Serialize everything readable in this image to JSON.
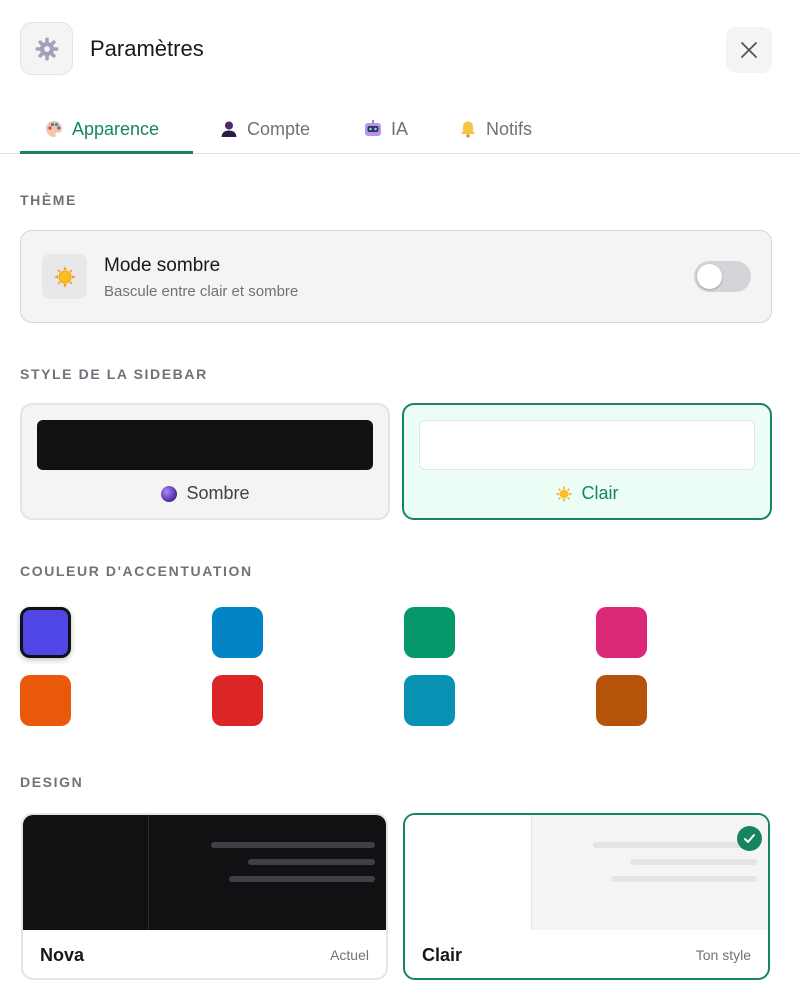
{
  "header": {
    "title": "Paramètres",
    "app_icon": "gear-icon",
    "close_icon": "close-icon"
  },
  "tabs": [
    {
      "label": "Apparence",
      "icon": "palette-icon",
      "active": true
    },
    {
      "label": "Compte",
      "icon": "user-icon",
      "active": false
    },
    {
      "label": "IA",
      "icon": "robot-icon",
      "active": false
    },
    {
      "label": "Notifs",
      "icon": "bell-icon",
      "active": false
    }
  ],
  "theme": {
    "section_label": "THÈME",
    "title": "Mode sombre",
    "subtitle": "Bascule entre clair et sombre",
    "icon": "sun-icon",
    "enabled": false
  },
  "sidebar_style": {
    "section_label": "STYLE DE LA SIDEBAR",
    "options": [
      {
        "label": "Sombre",
        "icon": "purple-orb-icon",
        "selected": false
      },
      {
        "label": "Clair",
        "icon": "sun-icon",
        "selected": true
      }
    ]
  },
  "accent": {
    "section_label": "COULEUR D'ACCENTUATION",
    "colors": [
      "#4f46e5",
      "#0284c7",
      "#059669",
      "#db2777",
      "#ea580c",
      "#dc2626",
      "#0891b2",
      "#b45309"
    ],
    "selected_index": 0
  },
  "design": {
    "section_label": "DESIGN",
    "options": [
      {
        "name": "Nova",
        "tag": "Actuel",
        "selected": false
      },
      {
        "name": "Clair",
        "tag": "Ton style",
        "selected": true
      }
    ]
  },
  "colors": {
    "brand_green": "#16855f",
    "text_muted": "#71717a"
  }
}
